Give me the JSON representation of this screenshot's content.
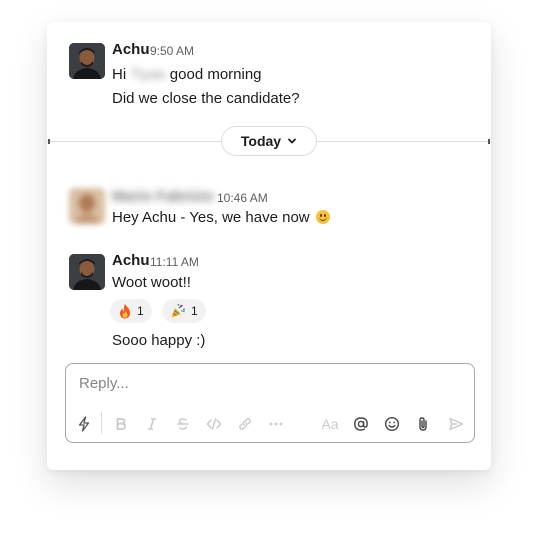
{
  "messages": [
    {
      "author": "Achu",
      "time": "9:50 AM",
      "lines": {
        "greeting_before": "Hi",
        "greeting_hidden": "Tiyas",
        "greeting_after": "good morning",
        "second": "Did we close the candidate?"
      }
    },
    {
      "author": "Mario Fabrizio",
      "time": "10:46 AM",
      "text": "Hey Achu - Yes, we have now"
    },
    {
      "author": "Achu",
      "time": "11:11 AM",
      "text": "Woot woot!!",
      "reactions": [
        {
          "emoji": "fire",
          "count": "1"
        },
        {
          "emoji": "party-popper",
          "count": "1"
        }
      ],
      "followup": "Sooo happy :)"
    }
  ],
  "date_divider": {
    "label": "Today"
  },
  "composer": {
    "placeholder": "Reply...",
    "tools": [
      "shortcuts-icon",
      "bold-icon",
      "italic-icon",
      "strikethrough-icon",
      "code-icon",
      "link-icon",
      "more-icon",
      "formatting-icon",
      "mention-icon",
      "emoji-icon",
      "attach-icon",
      "send-icon"
    ],
    "formatting_label": "Aa"
  }
}
